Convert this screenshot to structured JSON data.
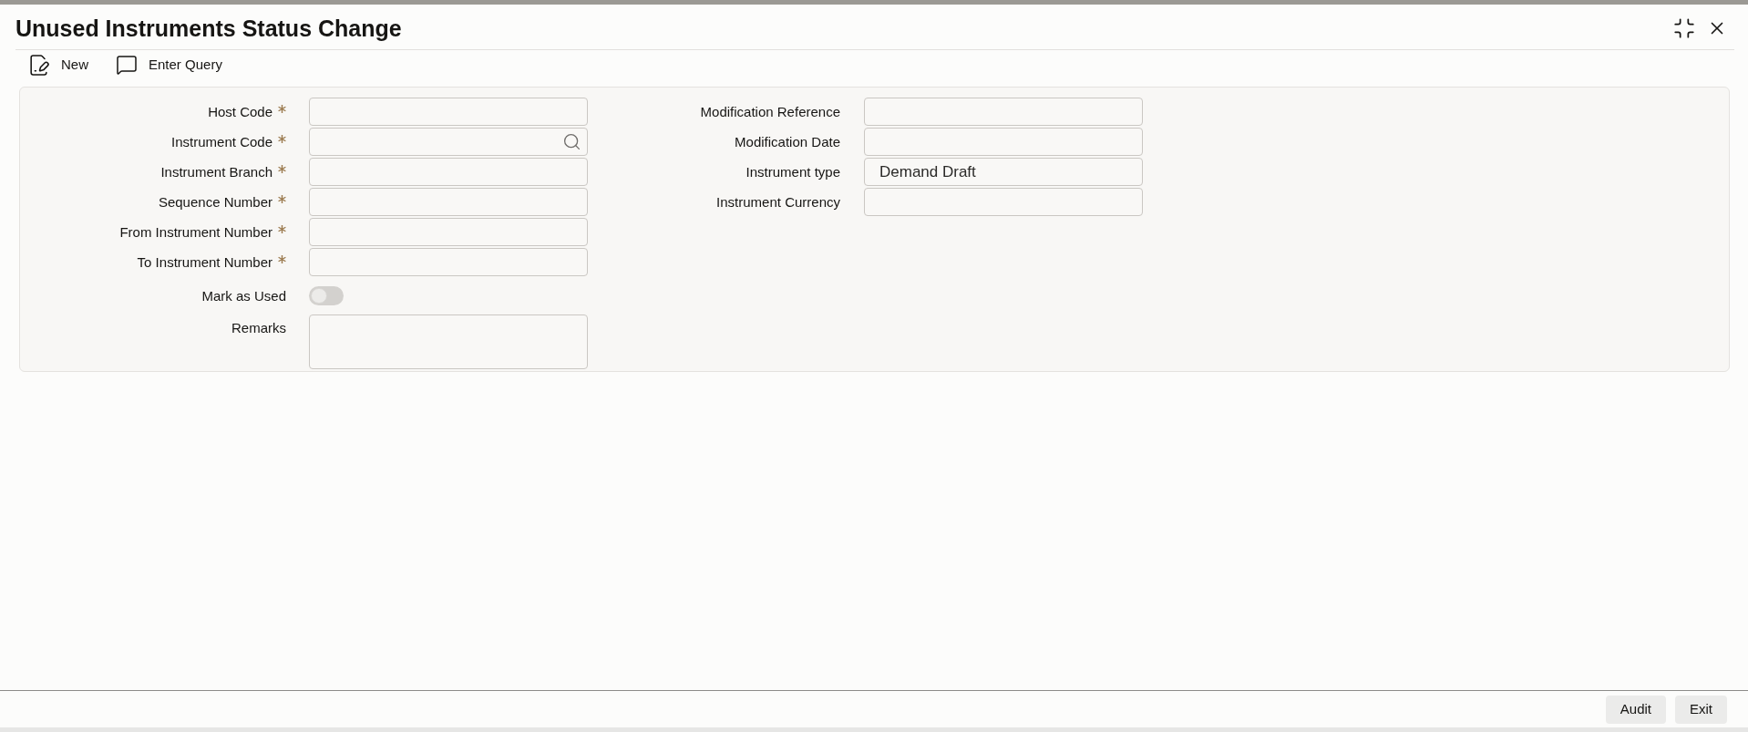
{
  "window": {
    "title": "Unused Instruments Status Change"
  },
  "toolbar": [
    {
      "kind": "new",
      "label": "New"
    },
    {
      "kind": "query",
      "label": "Enter Query"
    }
  ],
  "form": {
    "left_fields": [
      {
        "kind": "text",
        "label": "Host Code",
        "required": true
      },
      {
        "kind": "lookup",
        "label": "Instrument Code",
        "required": true
      },
      {
        "kind": "text",
        "label": "Instrument Branch",
        "required": true
      },
      {
        "kind": "text",
        "label": "Sequence Number",
        "required": true
      },
      {
        "kind": "text",
        "label": "From Instrument Number",
        "required": true
      },
      {
        "kind": "text",
        "label": "To Instrument Number",
        "required": true
      },
      {
        "kind": "toggle",
        "label": "Mark as Used",
        "required": false,
        "on": false
      },
      {
        "kind": "textarea",
        "label": "Remarks",
        "required": false
      }
    ],
    "right_fields": [
      {
        "kind": "text",
        "label": "Modification Reference",
        "required": false
      },
      {
        "kind": "text",
        "label": "Modification Date",
        "required": false
      },
      {
        "kind": "text",
        "label": "Instrument type",
        "required": false,
        "value": "Demand Draft"
      },
      {
        "kind": "text",
        "label": "Instrument Currency",
        "required": false
      }
    ]
  },
  "footer_buttons": [
    "Audit",
    "Exit"
  ]
}
